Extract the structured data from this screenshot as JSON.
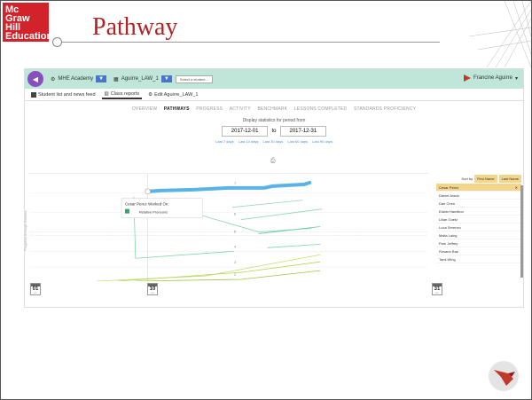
{
  "brand": {
    "line1": "Mc",
    "line2": "Graw",
    "line3": "Hill",
    "line4": "Education"
  },
  "slide_title": "Pathway",
  "app": {
    "org": "MHE Academy",
    "class_name": "Aguirre_LAW_1",
    "student_select_placeholder": "Select a student...",
    "user_name": "Francine Aguirre"
  },
  "tabs": [
    {
      "label": "Student list and news feed"
    },
    {
      "label": "Class reports"
    },
    {
      "label": "Edit Aguirre_LAW_1"
    }
  ],
  "subnav": [
    "OVERVIEW",
    "PATHWAYS",
    "PROGRESS",
    "ACTIVITY",
    "BENCHMARK",
    "LESSONS COMPLETED",
    "STANDARDS PROFICIENCY"
  ],
  "period": {
    "label": "Display statistics for period from",
    "from": "2017-12-01",
    "to_label": "to",
    "to": "2017-12-31",
    "quick": [
      "Last 7 days",
      "Last 14 days",
      "Last 30 days",
      "Last 60 days",
      "Last 90 days"
    ]
  },
  "chart": {
    "ylabel": "Progress through lessons",
    "tooltip_title": "Cesar Perez Worked On:",
    "tooltip_item": "Relative Pronouns",
    "levels": [
      "7",
      "6",
      "5",
      "4",
      "3",
      "2"
    ],
    "dates": [
      {
        "month": "DEC",
        "day": "01",
        "year": "2017"
      },
      {
        "month": "DEC",
        "day": "10",
        "year": "2017"
      },
      {
        "month": "DEC",
        "day": "31",
        "year": "2017"
      }
    ]
  },
  "sidebar": {
    "sort_by": "Sort by",
    "first_name": "First Name",
    "last_name": "Last Name",
    "students": [
      "Cesar Perez",
      "Daniel Arado",
      "Dae Chen",
      "Edwin Hamilton",
      "Lilian Goetz",
      "Luca Serenzo",
      "Malia Laing",
      "Pam Jeffrey",
      "Rosario Bas",
      "Tami Wing"
    ]
  }
}
